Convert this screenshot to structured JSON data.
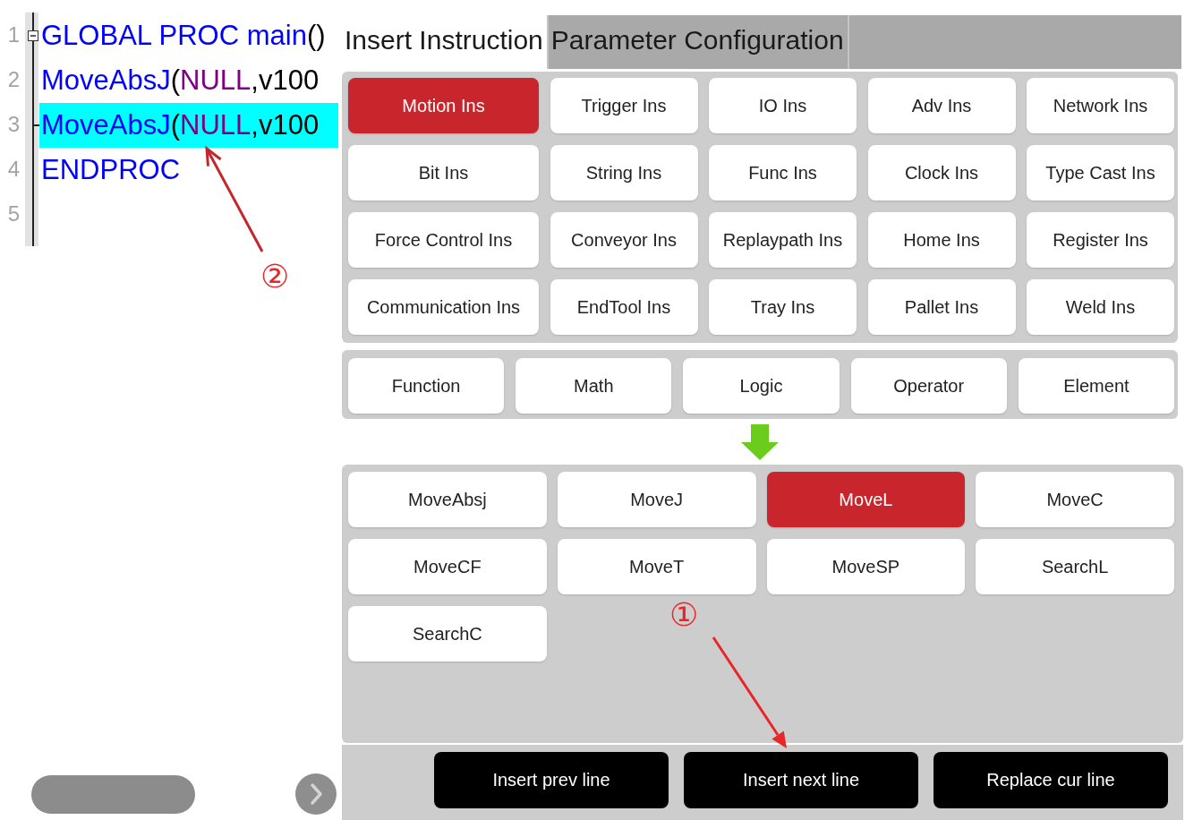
{
  "editor": {
    "lines": [
      {
        "number": "1",
        "selected": false,
        "fold_start": true,
        "fold_end": false,
        "tokens": [
          {
            "text": "GLOBAL PROC main",
            "kind": "keyword"
          },
          {
            "text": "()",
            "kind": "plain"
          }
        ]
      },
      {
        "number": "2",
        "selected": false,
        "fold_start": false,
        "fold_end": false,
        "tokens": [
          {
            "text": "MoveAbsJ",
            "kind": "keyword"
          },
          {
            "text": "(",
            "kind": "plain"
          },
          {
            "text": "NULL",
            "kind": "constant"
          },
          {
            "text": ",v100",
            "kind": "plain"
          }
        ]
      },
      {
        "number": "3",
        "selected": true,
        "fold_start": false,
        "fold_end": true,
        "tokens": [
          {
            "text": "MoveAbsJ",
            "kind": "keyword"
          },
          {
            "text": "(",
            "kind": "plain"
          },
          {
            "text": "NULL",
            "kind": "constant"
          },
          {
            "text": ",v100",
            "kind": "plain"
          }
        ]
      },
      {
        "number": "4",
        "selected": false,
        "fold_start": false,
        "fold_end": false,
        "tokens": [
          {
            "text": "ENDPROC",
            "kind": "keyword"
          }
        ]
      },
      {
        "number": "5",
        "selected": false,
        "fold_start": false,
        "fold_end": false
      }
    ]
  },
  "tabs": [
    {
      "label": "Insert Instruction",
      "selected": true
    },
    {
      "label": "Parameter Configuration",
      "selected": false
    }
  ],
  "categories": [
    {
      "label": "Motion Ins",
      "selected": true
    },
    {
      "label": "Trigger Ins",
      "selected": false
    },
    {
      "label": "IO Ins",
      "selected": false
    },
    {
      "label": "Adv Ins",
      "selected": false
    },
    {
      "label": "Network Ins",
      "selected": false
    },
    {
      "label": "Bit Ins",
      "selected": false
    },
    {
      "label": "String Ins",
      "selected": false
    },
    {
      "label": "Func Ins",
      "selected": false
    },
    {
      "label": "Clock Ins",
      "selected": false
    },
    {
      "label": "Type Cast Ins",
      "selected": false
    },
    {
      "label": "Force Control Ins",
      "selected": false
    },
    {
      "label": "Conveyor Ins",
      "selected": false
    },
    {
      "label": "Replaypath Ins",
      "selected": false
    },
    {
      "label": "Home Ins",
      "selected": false
    },
    {
      "label": "Register Ins",
      "selected": false
    },
    {
      "label": "Communication Ins",
      "selected": false
    },
    {
      "label": "EndTool Ins",
      "selected": false
    },
    {
      "label": "Tray Ins",
      "selected": false
    },
    {
      "label": "Pallet Ins",
      "selected": false
    },
    {
      "label": "Weld Ins",
      "selected": false
    }
  ],
  "expression_buttons": [
    "Function",
    "Math",
    "Logic",
    "Operator",
    "Element"
  ],
  "instructions": [
    {
      "label": "MoveAbsj",
      "selected": false
    },
    {
      "label": "MoveJ",
      "selected": false
    },
    {
      "label": "MoveL",
      "selected": true
    },
    {
      "label": "MoveC",
      "selected": false
    },
    {
      "label": "MoveCF",
      "selected": false
    },
    {
      "label": "MoveT",
      "selected": false
    },
    {
      "label": "MoveSP",
      "selected": false
    },
    {
      "label": "SearchL",
      "selected": false
    },
    {
      "label": "SearchC",
      "selected": false
    }
  ],
  "actions": [
    "Insert prev line",
    "Insert next line",
    "Replace cur line"
  ],
  "annotations": [
    {
      "label": "②"
    },
    {
      "label": "①"
    }
  ]
}
